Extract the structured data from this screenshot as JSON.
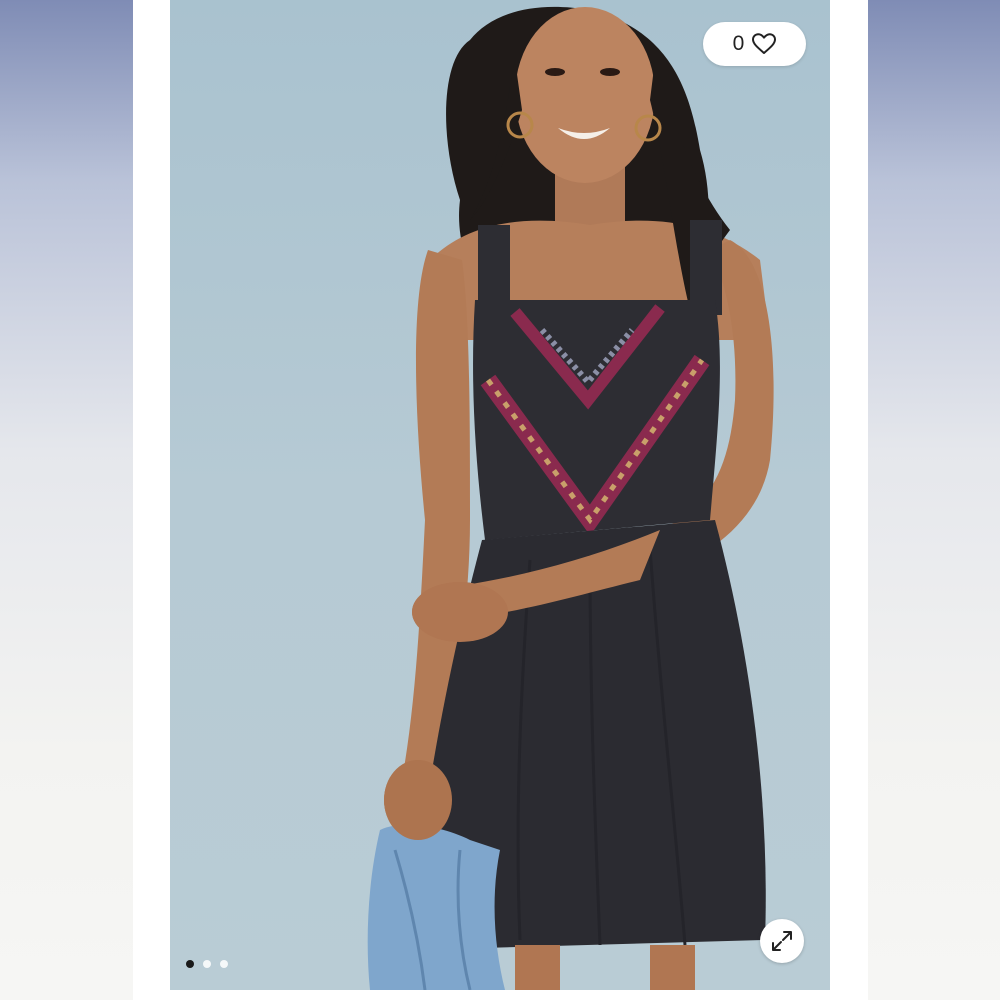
{
  "like": {
    "count": "0",
    "icon": "heart-icon"
  },
  "expand": {
    "icon": "expand-arrows-icon"
  },
  "carousel": {
    "total": 3,
    "active_index": 0
  },
  "photo": {
    "background_color": "#b3c8d2",
    "dress_color": "#2d2d33",
    "embroidery_color": "#8a2a4e"
  }
}
